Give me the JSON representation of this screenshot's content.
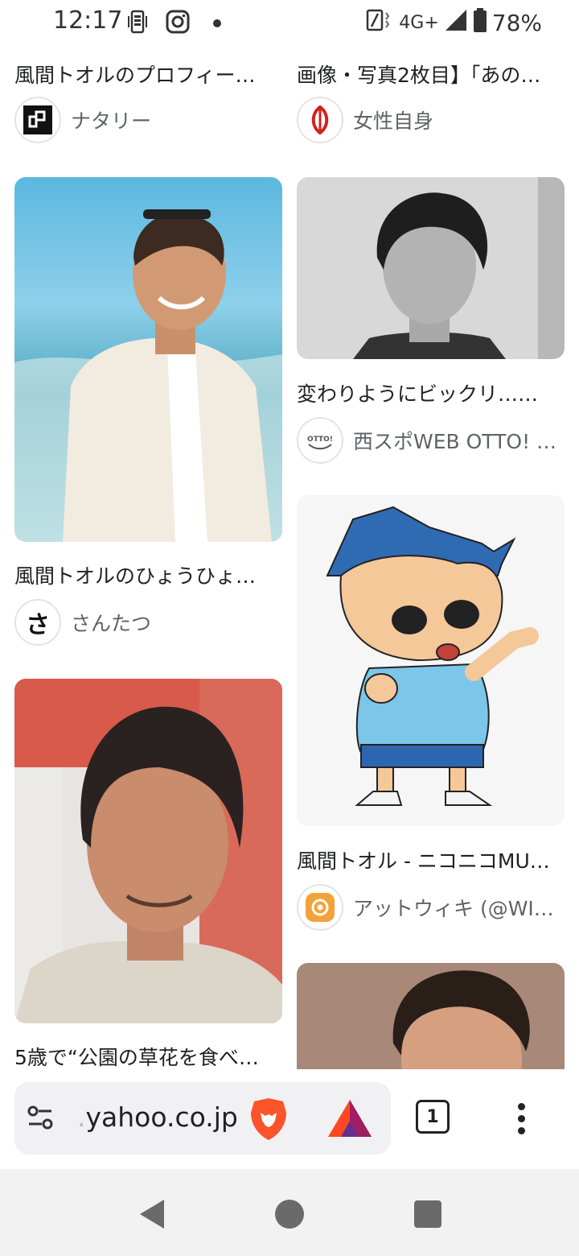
{
  "status_bar": {
    "time": "12:17",
    "network": "4G+",
    "battery": "78%"
  },
  "results": {
    "top_left": {
      "title": "風間トオルのプロフィー…",
      "source": "ナタリー"
    },
    "top_right": {
      "title": "画像・写真2枚目】「あの…",
      "source": "女性自身"
    },
    "item1": {
      "title": "風間トオルのひょうひょ…",
      "source": "さんたつ",
      "logo_char": "さ"
    },
    "item2": {
      "title": "変わりようにビックリ……",
      "source": "西スポWEB OTTO! - …",
      "logo_text": "OTTO!"
    },
    "item3": {
      "title": "風間トオル - ニコニコMU…",
      "source": "アットウィキ (@WI…"
    },
    "item4": {
      "title": "5歳で“公園の草花を食べ…"
    }
  },
  "browser": {
    "url": "yahoo.co.jp",
    "url_prefix": ".",
    "tab_count": "1"
  },
  "colors": {
    "accent_brave": "#fb542b",
    "bat_purple": "#662d91"
  }
}
